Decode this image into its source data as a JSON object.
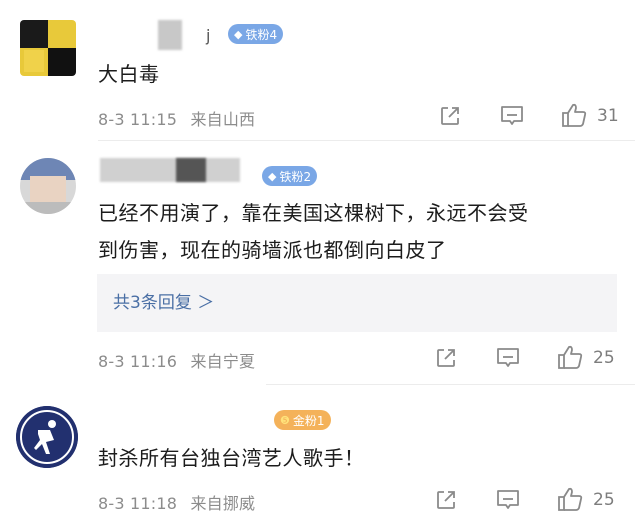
{
  "comments": [
    {
      "badge": "铁粉4",
      "text": "大白毒",
      "time": "8-3 11:15",
      "location": "来自山西",
      "likes": "31"
    },
    {
      "badge": "铁粉2",
      "text_line1": "已经不用演了，靠在美国这棵树下，永远不会受",
      "text_line2": "到伤害，现在的骑墙派也都倒向白皮了",
      "reply_summary": "共3条回复 ＞",
      "time": "8-3 11:16",
      "location": "来自宁夏",
      "likes": "25"
    },
    {
      "badge": "金粉1",
      "text": "封杀所有台独台湾艺人歌手！",
      "time": "8-3 11:18",
      "location": "来自挪威",
      "likes": "25"
    }
  ],
  "icons": {
    "share": "share-icon",
    "comment": "comment-icon",
    "like": "thumbs-up-icon",
    "badge_fan": "diamond-icon"
  },
  "colors": {
    "fan_badge": "#7aa7e6",
    "gold_badge": "#f4b25a",
    "meta_text": "#8c8c8c",
    "reply_link": "#4a6fa5"
  }
}
